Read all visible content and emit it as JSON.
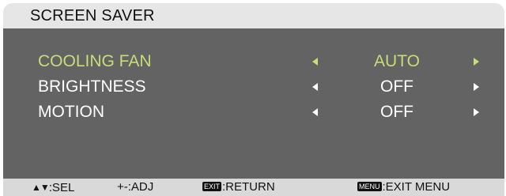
{
  "header": {
    "title": "SCREEN SAVER"
  },
  "settings": [
    {
      "label": "COOLING FAN",
      "value": "AUTO",
      "selected": true
    },
    {
      "label": "BRIGHTNESS",
      "value": "OFF",
      "selected": false
    },
    {
      "label": "MOTION",
      "value": "OFF",
      "selected": false
    }
  ],
  "footer": {
    "sel": {
      "icon": "up-down-arrows",
      "glyph": "▲▼",
      "label": ":SEL"
    },
    "adj": {
      "label": "+-:ADJ"
    },
    "return": {
      "key": "EXIT",
      "label": ":RETURN"
    },
    "exit_menu": {
      "key": "MENU",
      "label": ":EXIT MENU"
    }
  },
  "colors": {
    "panel": "#636363",
    "header": "#e6e6e6",
    "footer": "#d9d9d9",
    "selected_text": "#c8dc78",
    "normal_text": "#ffffff"
  }
}
